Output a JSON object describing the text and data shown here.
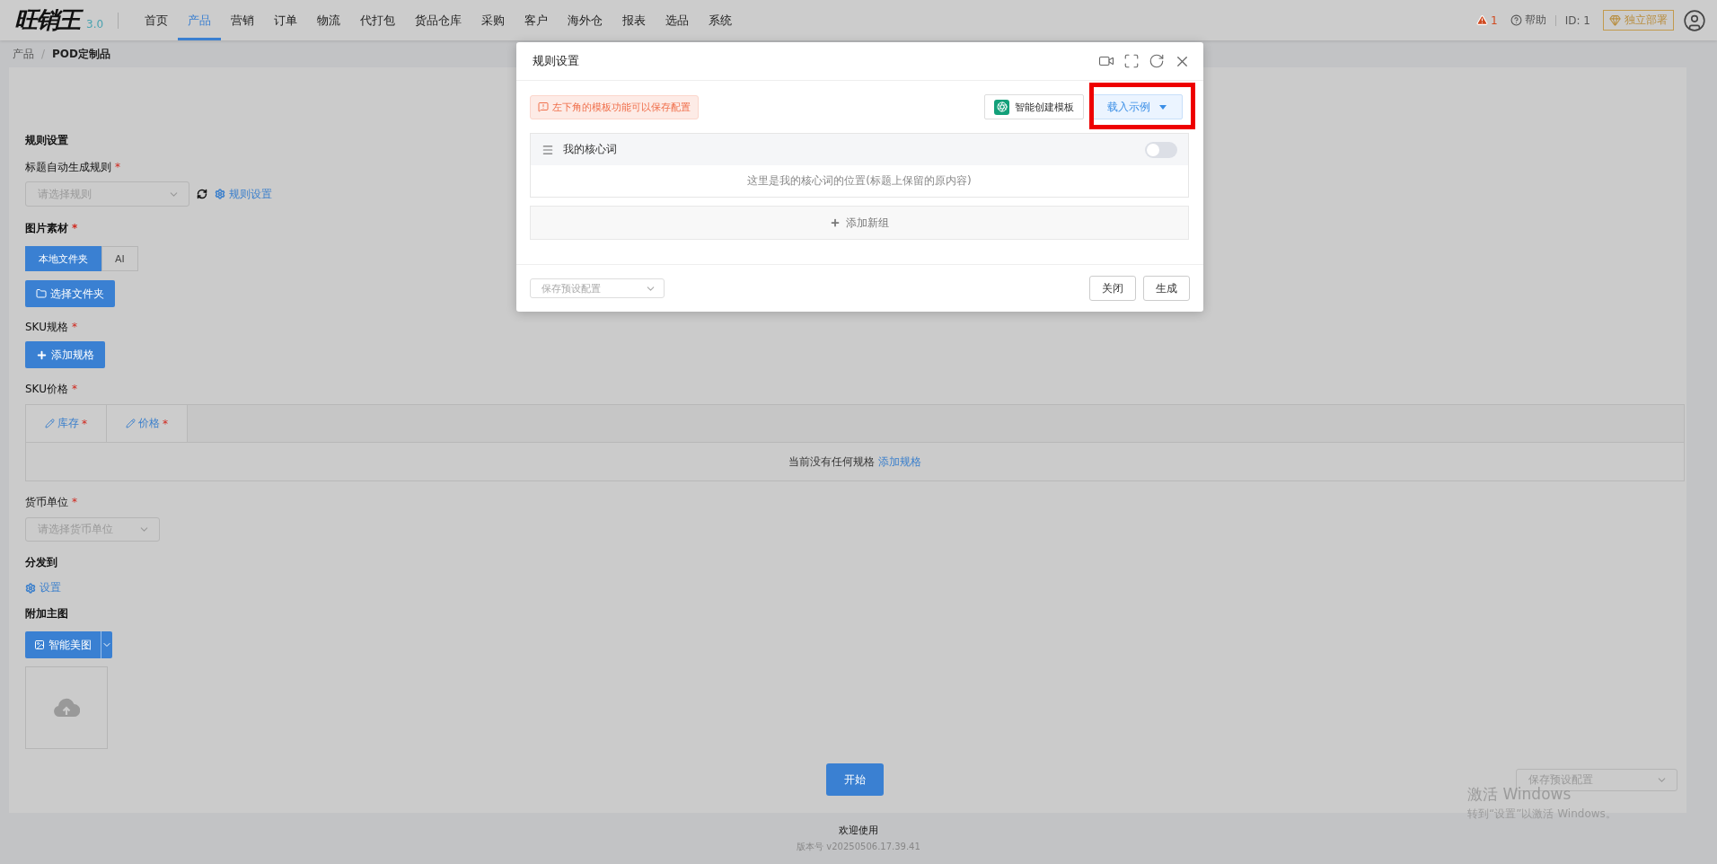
{
  "top_nav": {
    "logo": "旺销王",
    "version": "3.0",
    "items": [
      {
        "label": "首页",
        "selected": false
      },
      {
        "label": "产品",
        "selected": true
      },
      {
        "label": "营销",
        "selected": false
      },
      {
        "label": "订单",
        "selected": false
      },
      {
        "label": "物流",
        "selected": false
      },
      {
        "label": "代打包",
        "selected": false
      },
      {
        "label": "货品仓库",
        "selected": false
      },
      {
        "label": "采购",
        "selected": false
      },
      {
        "label": "客户",
        "selected": false
      },
      {
        "label": "海外仓",
        "selected": false
      },
      {
        "label": "报表",
        "selected": false
      },
      {
        "label": "选品",
        "selected": false
      },
      {
        "label": "系统",
        "selected": false
      }
    ],
    "alert_count": "1",
    "help": "帮助",
    "user_id": "ID: 1",
    "deploy_button": "独立部署"
  },
  "breadcrumb": {
    "items": [
      "产品",
      "POD定制品"
    ],
    "separator": "/"
  },
  "form": {
    "heading": "规则设置",
    "title_rule": {
      "label": "标题自动生成规则",
      "required_mark": "*",
      "placeholder": "请选择规则",
      "settings_link": "规则设置"
    },
    "image_material": {
      "label": "图片素材",
      "required_mark": "*",
      "source_tabs": [
        {
          "label": "本地文件夹",
          "selected": true
        },
        {
          "label": "AI",
          "selected": false
        }
      ],
      "choose_folder_button": "选择文件夹"
    },
    "sku_spec": {
      "label": "SKU规格",
      "required_mark": "*",
      "add_button": "添加规格"
    },
    "sku_price": {
      "label": "SKU价格",
      "required_mark": "*",
      "columns": [
        {
          "label": "库存",
          "required_mark": "*"
        },
        {
          "label": "价格",
          "required_mark": "*"
        }
      ],
      "empty_text": "当前没有任何规格",
      "empty_link": "添加规格"
    },
    "currency": {
      "label": "货币单位",
      "required_mark": "*",
      "placeholder": "请选择货币单位"
    },
    "distribute": {
      "label": "分发到",
      "settings_link": "设置"
    },
    "extra_main_image": {
      "label": "附加主图",
      "beautify_button": "智能美图"
    },
    "start_button": "开始",
    "preset_select": {
      "placeholder": "保存预设配置"
    }
  },
  "footer": {
    "welcome": "欢迎使用",
    "version": "版本号 v20250506.17.39.41"
  },
  "dialog": {
    "title": "规则设置",
    "tip": "左下角的模板功能可以保存配置",
    "ai_template_button": "智能创建模板",
    "load_example_button": "载入示例",
    "groups": [
      {
        "name": "我的核心词",
        "on": false,
        "description": "这里是我的核心词的位置(标题上保留的原内容)"
      }
    ],
    "add_group_button": "添加新组",
    "preset_select": {
      "placeholder": "保存预设配置"
    },
    "close_button": "关闭",
    "generate_button": "生成"
  },
  "os_notice": {
    "title": "激活 Windows",
    "subtitle": "转到“设置”以激活 Windows。"
  }
}
